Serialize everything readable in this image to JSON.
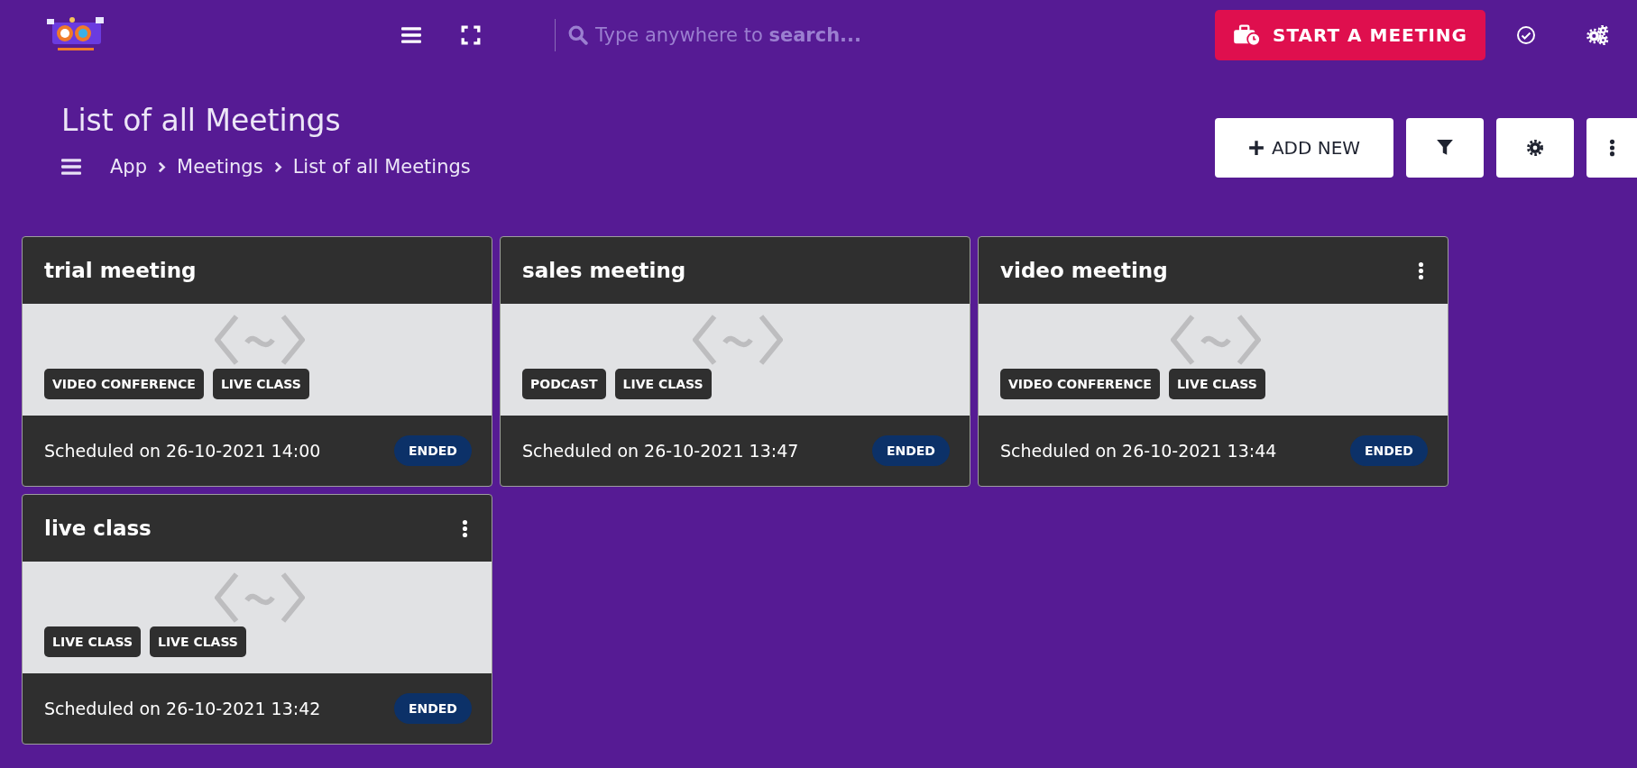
{
  "topbar": {
    "search": {
      "placeholder": "Type anywhere to **search...**"
    },
    "primary_button": "START A MEETING"
  },
  "header": {
    "title": "List of all Meetings",
    "breadcrumb": [
      "App",
      "Meetings",
      "List of all Meetings"
    ],
    "add_button": "ADD NEW"
  },
  "meetings": [
    {
      "title": "trial meeting",
      "has_menu": false,
      "tags": [
        "VIDEO CONFERENCE",
        "LIVE CLASS"
      ],
      "scheduled": "Scheduled on 26-10-2021 14:00",
      "status": "ENDED"
    },
    {
      "title": "sales meeting",
      "has_menu": false,
      "tags": [
        "PODCAST",
        "LIVE CLASS"
      ],
      "scheduled": "Scheduled on 26-10-2021 13:47",
      "status": "ENDED"
    },
    {
      "title": "video meeting",
      "has_menu": true,
      "tags": [
        "VIDEO CONFERENCE",
        "LIVE CLASS"
      ],
      "scheduled": "Scheduled on 26-10-2021 13:44",
      "status": "ENDED"
    },
    {
      "title": "live class",
      "has_menu": true,
      "tags": [
        "LIVE CLASS",
        "LIVE CLASS"
      ],
      "scheduled": "Scheduled on 26-10-2021 13:42",
      "status": "ENDED"
    }
  ]
}
